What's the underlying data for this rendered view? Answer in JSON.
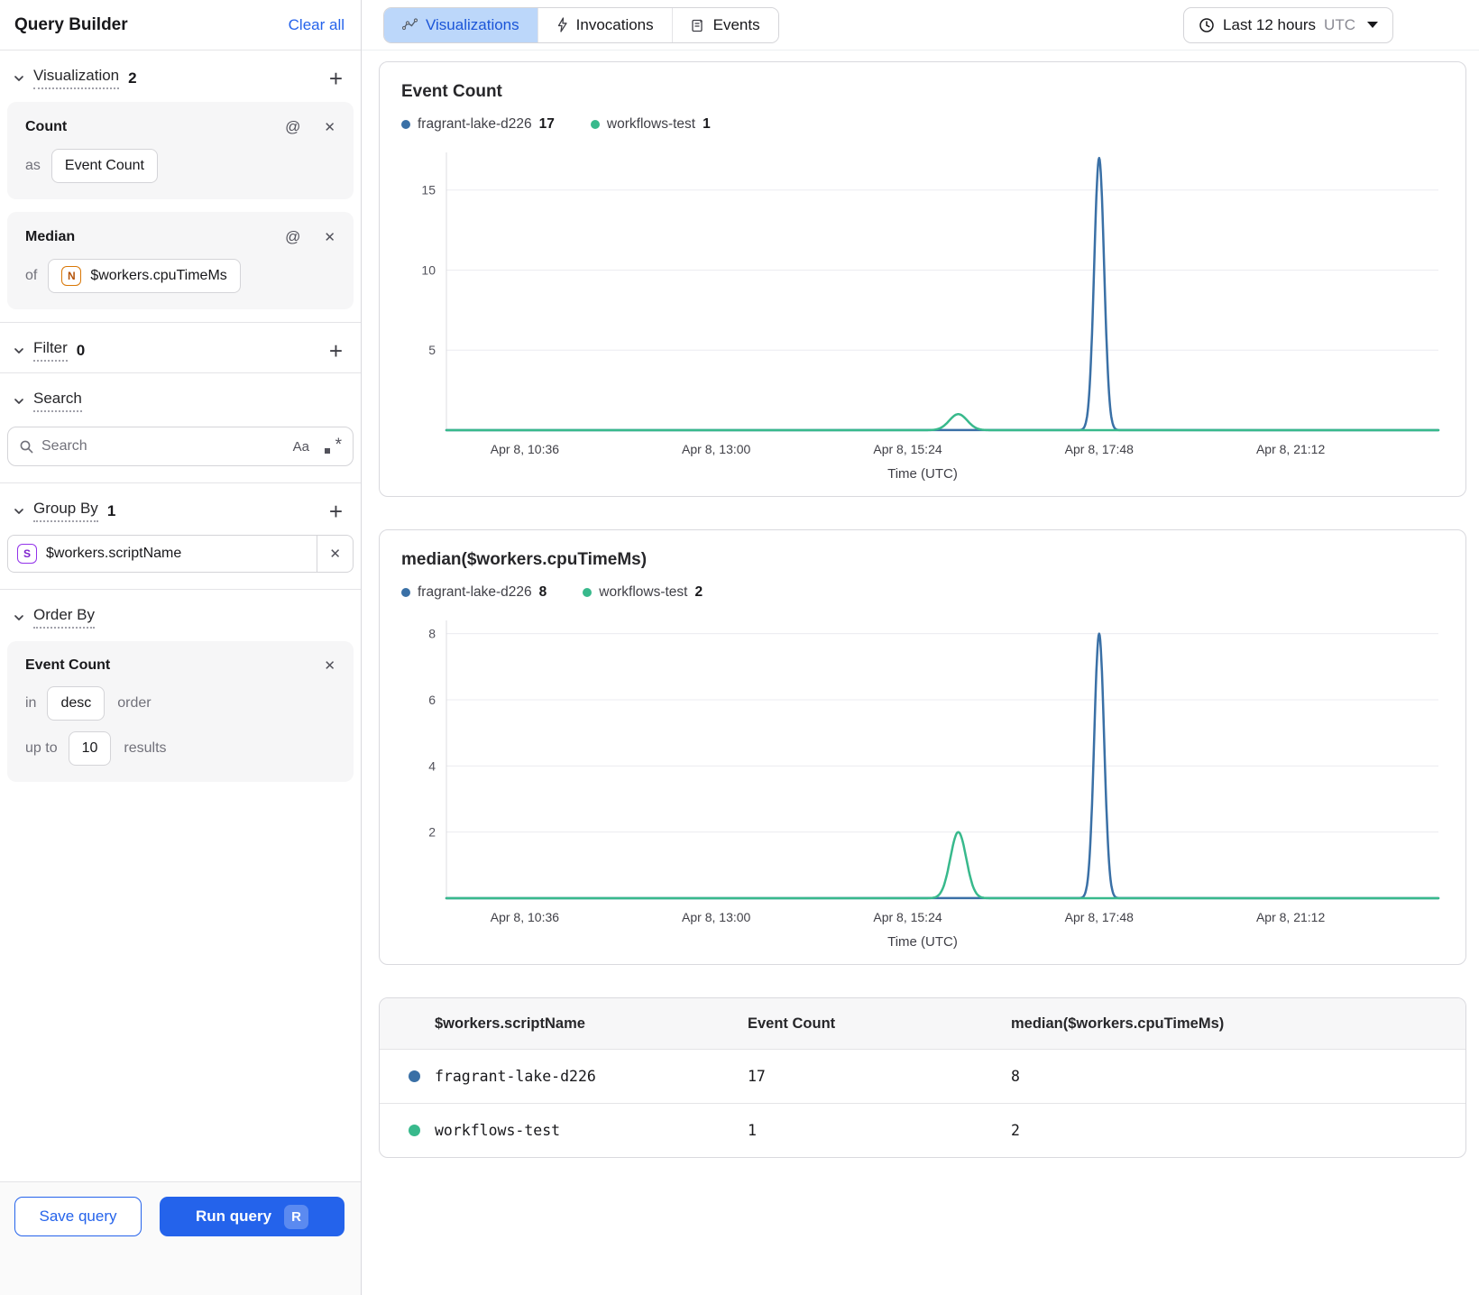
{
  "sidebar": {
    "title": "Query Builder",
    "clear_all": "Clear all",
    "visualization": {
      "label": "Visualization",
      "count": "2",
      "cards": [
        {
          "title": "Count",
          "prefix": "as",
          "value": "Event Count"
        },
        {
          "title": "Median",
          "prefix": "of",
          "field_type_letter": "N",
          "value": "$workers.cpuTimeMs"
        }
      ]
    },
    "filter": {
      "label": "Filter",
      "count": "0"
    },
    "search": {
      "label": "Search",
      "placeholder": "Search",
      "match_case_icon": "Aa"
    },
    "group_by": {
      "label": "Group By",
      "count": "1",
      "items": [
        {
          "field_type_letter": "S",
          "value": "$workers.scriptName"
        }
      ]
    },
    "order_by": {
      "label": "Order By",
      "field": "Event Count",
      "in_label": "in",
      "direction": "desc",
      "order_label": "order",
      "up_to_label": "up to",
      "limit": "10",
      "results_label": "results"
    },
    "save_button": "Save query",
    "run_button": "Run query",
    "run_shortcut": "R"
  },
  "topbar": {
    "tabs": [
      {
        "label": "Visualizations",
        "active": true
      },
      {
        "label": "Invocations",
        "active": false
      },
      {
        "label": "Events",
        "active": false
      }
    ],
    "time_range": {
      "label": "Last 12 hours",
      "timezone": "UTC"
    }
  },
  "colors": {
    "accent_blue": "#2463eb",
    "tab_active_bg": "#bcd7fa",
    "series_blue": "#3a70a6",
    "series_green": "#38b98c"
  },
  "chart_data": [
    {
      "type": "line",
      "title": "Event Count",
      "xlabel": "Time (UTC)",
      "x_tick_labels": [
        "Apr 8, 10:36",
        "Apr 8, 13:00",
        "Apr 8, 15:24",
        "Apr 8, 17:48",
        "Apr 8, 21:12"
      ],
      "x_tick_fracs": [
        0.079,
        0.272,
        0.465,
        0.658,
        0.851
      ],
      "y_ticks": [
        5,
        10,
        15
      ],
      "ylim": [
        0,
        17.35
      ],
      "grid": true,
      "legend": [
        {
          "name": "fragrant-lake-d226",
          "value": "17",
          "color": "#3a70a6"
        },
        {
          "name": "workflows-test",
          "value": "1",
          "color": "#38b98c"
        }
      ],
      "series": [
        {
          "name": "fragrant-lake-d226",
          "color": "#3a70a6",
          "baseline": 0,
          "peaks": [
            {
              "x_frac": 0.658,
              "value": 17,
              "sigma": 0.005
            }
          ]
        },
        {
          "name": "workflows-test",
          "color": "#38b98c",
          "baseline": 0,
          "peaks": [
            {
              "x_frac": 0.516,
              "value": 1,
              "sigma": 0.009
            }
          ]
        }
      ]
    },
    {
      "type": "line",
      "title": "median($workers.cpuTimeMs)",
      "xlabel": "Time (UTC)",
      "x_tick_labels": [
        "Apr 8, 10:36",
        "Apr 8, 13:00",
        "Apr 8, 15:24",
        "Apr 8, 17:48",
        "Apr 8, 21:12"
      ],
      "x_tick_fracs": [
        0.079,
        0.272,
        0.465,
        0.658,
        0.851
      ],
      "y_ticks": [
        2,
        4,
        6,
        8
      ],
      "ylim": [
        0,
        8.4
      ],
      "grid": true,
      "legend": [
        {
          "name": "fragrant-lake-d226",
          "value": "8",
          "color": "#3a70a6"
        },
        {
          "name": "workflows-test",
          "value": "2",
          "color": "#38b98c"
        }
      ],
      "series": [
        {
          "name": "fragrant-lake-d226",
          "color": "#3a70a6",
          "baseline": 0,
          "peaks": [
            {
              "x_frac": 0.658,
              "value": 8,
              "sigma": 0.005
            }
          ]
        },
        {
          "name": "workflows-test",
          "color": "#38b98c",
          "baseline": 0,
          "peaks": [
            {
              "x_frac": 0.516,
              "value": 2,
              "sigma": 0.008
            }
          ]
        }
      ]
    }
  ],
  "table": {
    "headers": [
      "$workers.scriptName",
      "Event Count",
      "median($workers.cpuTimeMs)"
    ],
    "rows": [
      {
        "dot_color": "#3a70a6",
        "name": "fragrant-lake-d226",
        "event_count": "17",
        "median": "8"
      },
      {
        "dot_color": "#38b98c",
        "name": "workflows-test",
        "event_count": "1",
        "median": "2"
      }
    ]
  }
}
